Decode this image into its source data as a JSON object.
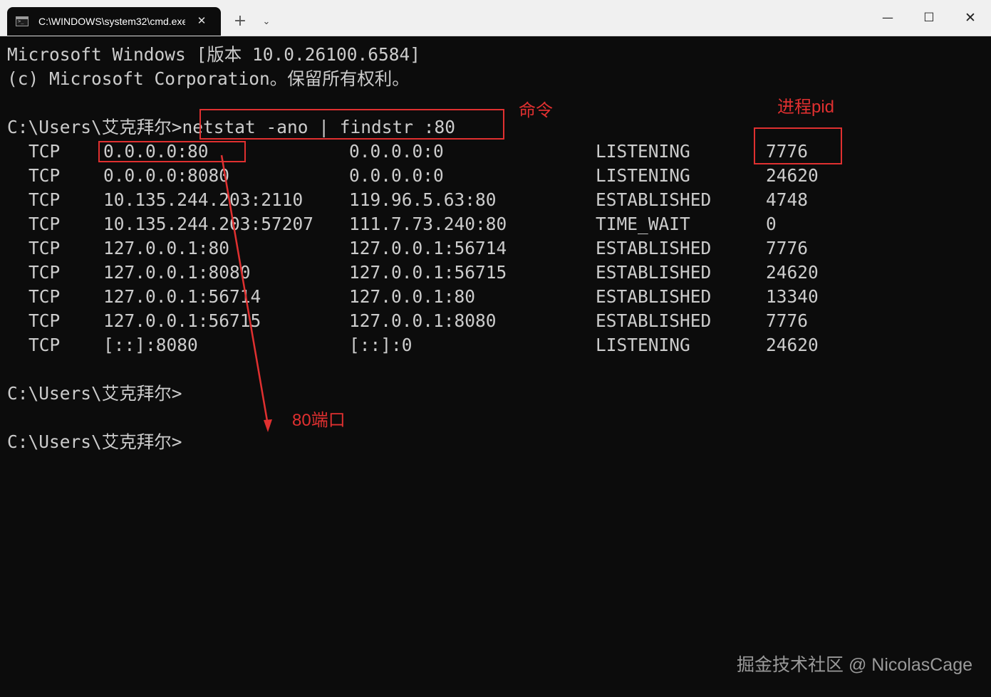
{
  "window": {
    "tab_title": "C:\\WINDOWS\\system32\\cmd.exe",
    "tab_icon": "console-icon",
    "close_tab_glyph": "✕",
    "new_tab_glyph": "+",
    "dropdown_glyph": "⌄",
    "minimize_glyph": "—",
    "maximize_glyph": "☐",
    "close_glyph": "✕"
  },
  "terminal": {
    "header_line1": "Microsoft Windows [版本 10.0.26100.6584]",
    "header_line2": "(c) Microsoft Corporation。保留所有权利。",
    "command_line": "C:\\Users\\艾克拜尔>netstat -ano | findstr :80",
    "rows": [
      {
        "proto": "TCP",
        "local": "0.0.0.0:80",
        "foreign": "0.0.0.0:0",
        "state": "LISTENING",
        "pid": "7776"
      },
      {
        "proto": "TCP",
        "local": "0.0.0.0:8080",
        "foreign": "0.0.0.0:0",
        "state": "LISTENING",
        "pid": "24620"
      },
      {
        "proto": "TCP",
        "local": "10.135.244.203:2110",
        "foreign": "119.96.5.63:80",
        "state": "ESTABLISHED",
        "pid": "4748"
      },
      {
        "proto": "TCP",
        "local": "10.135.244.203:57207",
        "foreign": "111.7.73.240:80",
        "state": "TIME_WAIT",
        "pid": "0"
      },
      {
        "proto": "TCP",
        "local": "127.0.0.1:80",
        "foreign": "127.0.0.1:56714",
        "state": "ESTABLISHED",
        "pid": "7776"
      },
      {
        "proto": "TCP",
        "local": "127.0.0.1:8080",
        "foreign": "127.0.0.1:56715",
        "state": "ESTABLISHED",
        "pid": "24620"
      },
      {
        "proto": "TCP",
        "local": "127.0.0.1:56714",
        "foreign": "127.0.0.1:80",
        "state": "ESTABLISHED",
        "pid": "13340"
      },
      {
        "proto": "TCP",
        "local": "127.0.0.1:56715",
        "foreign": "127.0.0.1:8080",
        "state": "ESTABLISHED",
        "pid": "7776"
      },
      {
        "proto": "TCP",
        "local": "[::]:8080",
        "foreign": "[::]:0",
        "state": "LISTENING",
        "pid": "24620"
      }
    ],
    "prompt1": "C:\\Users\\艾克拜尔>",
    "prompt2": "C:\\Users\\艾克拜尔>"
  },
  "annotations": {
    "color": "#e03030",
    "command_label": "命令",
    "pid_label": "进程pid",
    "port_label": "80端口"
  },
  "watermark": "掘金技术社区 @ NicolasCage"
}
